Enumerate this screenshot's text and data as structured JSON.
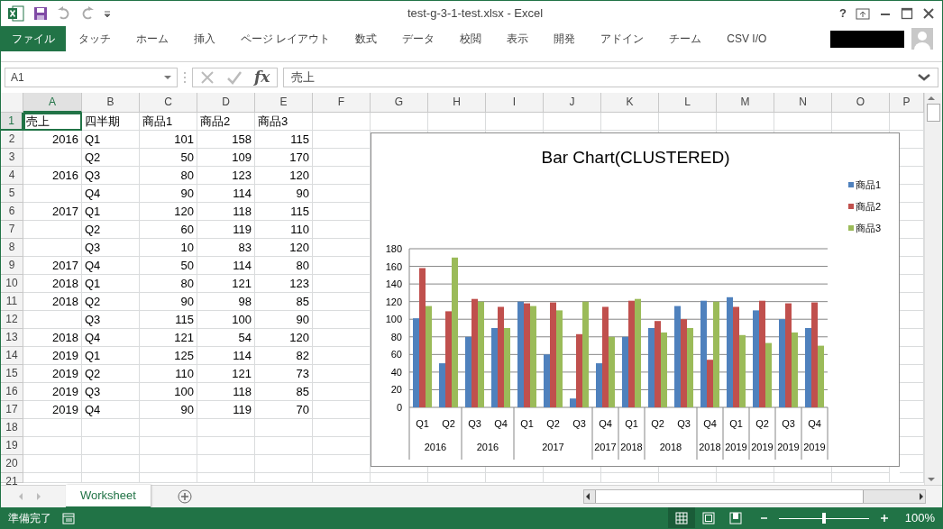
{
  "window": {
    "title": "test-g-3-1-test.xlsx - Excel",
    "help": "?"
  },
  "ribbon_tabs": [
    {
      "label": "ファイル",
      "selected": true
    },
    {
      "label": "タッチ",
      "selected": false
    },
    {
      "label": "ホーム",
      "selected": false
    },
    {
      "label": "挿入",
      "selected": false
    },
    {
      "label": "ページ レイアウト",
      "selected": false
    },
    {
      "label": "数式",
      "selected": false
    },
    {
      "label": "データ",
      "selected": false
    },
    {
      "label": "校閲",
      "selected": false
    },
    {
      "label": "表示",
      "selected": false
    },
    {
      "label": "開発",
      "selected": false
    },
    {
      "label": "アドイン",
      "selected": false
    },
    {
      "label": "チーム",
      "selected": false
    },
    {
      "label": "CSV I/O",
      "selected": false
    }
  ],
  "formula_bar": {
    "name_box": "A1",
    "function_label": "fx",
    "formula": "売上"
  },
  "sheet": {
    "columns": [
      {
        "label": "A",
        "selected": true
      },
      {
        "label": "B",
        "selected": false
      },
      {
        "label": "C",
        "selected": false
      },
      {
        "label": "D",
        "selected": false
      },
      {
        "label": "E",
        "selected": false
      },
      {
        "label": "F",
        "selected": false
      },
      {
        "label": "G",
        "selected": false
      },
      {
        "label": "H",
        "selected": false
      },
      {
        "label": "I",
        "selected": false
      },
      {
        "label": "J",
        "selected": false
      },
      {
        "label": "K",
        "selected": false
      },
      {
        "label": "L",
        "selected": false
      },
      {
        "label": "M",
        "selected": false
      },
      {
        "label": "N",
        "selected": false
      },
      {
        "label": "O",
        "selected": false
      },
      {
        "label": "P",
        "selected": false
      }
    ],
    "rows": [
      {
        "number": "1",
        "selected": true,
        "kind": "header",
        "cells": [
          "売上",
          "四半期",
          "商品1",
          "商品2",
          "商品3"
        ]
      },
      {
        "number": "2",
        "selected": false,
        "kind": "data",
        "cells": [
          "2016",
          "Q1",
          "101",
          "158",
          "115"
        ]
      },
      {
        "number": "3",
        "selected": false,
        "kind": "data",
        "cells": [
          null,
          "Q2",
          "50",
          "109",
          "170"
        ]
      },
      {
        "number": "4",
        "selected": false,
        "kind": "data",
        "cells": [
          "2016",
          "Q3",
          "80",
          "123",
          "120"
        ]
      },
      {
        "number": "5",
        "selected": false,
        "kind": "data",
        "cells": [
          null,
          "Q4",
          "90",
          "114",
          "90"
        ]
      },
      {
        "number": "6",
        "selected": false,
        "kind": "data",
        "cells": [
          "2017",
          "Q1",
          "120",
          "118",
          "115"
        ]
      },
      {
        "number": "7",
        "selected": false,
        "kind": "data",
        "cells": [
          null,
          "Q2",
          "60",
          "119",
          "110"
        ]
      },
      {
        "number": "8",
        "selected": false,
        "kind": "data",
        "cells": [
          null,
          "Q3",
          "10",
          "83",
          "120"
        ]
      },
      {
        "number": "9",
        "selected": false,
        "kind": "data",
        "cells": [
          "2017",
          "Q4",
          "50",
          "114",
          "80"
        ]
      },
      {
        "number": "10",
        "selected": false,
        "kind": "data",
        "cells": [
          "2018",
          "Q1",
          "80",
          "121",
          "123"
        ]
      },
      {
        "number": "11",
        "selected": false,
        "kind": "data",
        "cells": [
          "2018",
          "Q2",
          "90",
          "98",
          "85"
        ]
      },
      {
        "number": "12",
        "selected": false,
        "kind": "data",
        "cells": [
          null,
          "Q3",
          "115",
          "100",
          "90"
        ]
      },
      {
        "number": "13",
        "selected": false,
        "kind": "data",
        "cells": [
          "2018",
          "Q4",
          "121",
          "54",
          "120"
        ]
      },
      {
        "number": "14",
        "selected": false,
        "kind": "data",
        "cells": [
          "2019",
          "Q1",
          "125",
          "114",
          "82"
        ]
      },
      {
        "number": "15",
        "selected": false,
        "kind": "data",
        "cells": [
          "2019",
          "Q2",
          "110",
          "121",
          "73"
        ]
      },
      {
        "number": "16",
        "selected": false,
        "kind": "data",
        "cells": [
          "2019",
          "Q3",
          "100",
          "118",
          "85"
        ]
      },
      {
        "number": "17",
        "selected": false,
        "kind": "data",
        "cells": [
          "2019",
          "Q4",
          "90",
          "119",
          "70"
        ]
      },
      {
        "number": "18",
        "selected": false,
        "kind": "data",
        "cells": []
      },
      {
        "number": "19",
        "selected": false,
        "kind": "data",
        "cells": []
      },
      {
        "number": "20",
        "selected": false,
        "kind": "data",
        "cells": []
      },
      {
        "number": "21",
        "selected": false,
        "kind": "data",
        "cells": []
      }
    ]
  },
  "chart": {
    "chart_data": {
      "type": "bar",
      "title": "Bar Chart(CLUSTERED)",
      "categories": [
        "Q1",
        "Q2",
        "Q3",
        "Q4",
        "Q1",
        "Q2",
        "Q3",
        "Q4",
        "Q1",
        "Q2",
        "Q3",
        "Q4",
        "Q1",
        "Q2",
        "Q3",
        "Q4"
      ],
      "grid": true,
      "legend": "right",
      "series": [
        {
          "name": "商品1",
          "color": "#4f81bd",
          "values": [
            101,
            50,
            80,
            90,
            120,
            60,
            10,
            50,
            80,
            90,
            115,
            121,
            125,
            110,
            100,
            90
          ]
        },
        {
          "name": "商品2",
          "color": "#c0504d",
          "values": [
            158,
            109,
            123,
            114,
            118,
            119,
            83,
            114,
            121,
            98,
            100,
            54,
            114,
            121,
            118,
            119
          ]
        },
        {
          "name": "商品3",
          "color": "#9bbb59",
          "values": [
            115,
            170,
            120,
            90,
            115,
            110,
            120,
            80,
            123,
            85,
            90,
            120,
            82,
            73,
            85,
            70
          ]
        }
      ],
      "ylim": [
        0,
        180
      ],
      "yticks": [
        {
          "value": 0,
          "label": "0"
        },
        {
          "value": 20,
          "label": "20"
        },
        {
          "value": 40,
          "label": "40"
        },
        {
          "value": 60,
          "label": "60"
        },
        {
          "value": 80,
          "label": "80"
        },
        {
          "value": 100,
          "label": "100"
        },
        {
          "value": 120,
          "label": "120"
        },
        {
          "value": 140,
          "label": "140"
        },
        {
          "value": 160,
          "label": "160"
        },
        {
          "value": 180,
          "label": "180"
        }
      ]
    },
    "year_labels": [
      "2016",
      "2016",
      "2017",
      "2017",
      "2018",
      "2018",
      "2018",
      "2019",
      "2019",
      "2019",
      "2019"
    ],
    "category_dividers": [
      {
        "divider": false
      },
      {
        "divider": true
      },
      {
        "divider": false
      },
      {
        "divider": true
      },
      {
        "divider": false
      },
      {
        "divider": false
      },
      {
        "divider": true
      },
      {
        "divider": true
      },
      {
        "divider": true
      },
      {
        "divider": false
      },
      {
        "divider": true
      },
      {
        "divider": true
      },
      {
        "divider": true
      },
      {
        "divider": true
      },
      {
        "divider": true
      },
      {
        "divider": true
      }
    ]
  },
  "sheet_tabs": [
    {
      "label": "Worksheet",
      "selected": true
    }
  ],
  "status_bar": {
    "text": "準備完了",
    "views": [
      {
        "kind": "normal",
        "selected": true
      },
      {
        "kind": "page_layout",
        "selected": false
      },
      {
        "kind": "page_break",
        "selected": false
      }
    ],
    "zoom": {
      "level": 0.5,
      "reading": "100%"
    }
  }
}
